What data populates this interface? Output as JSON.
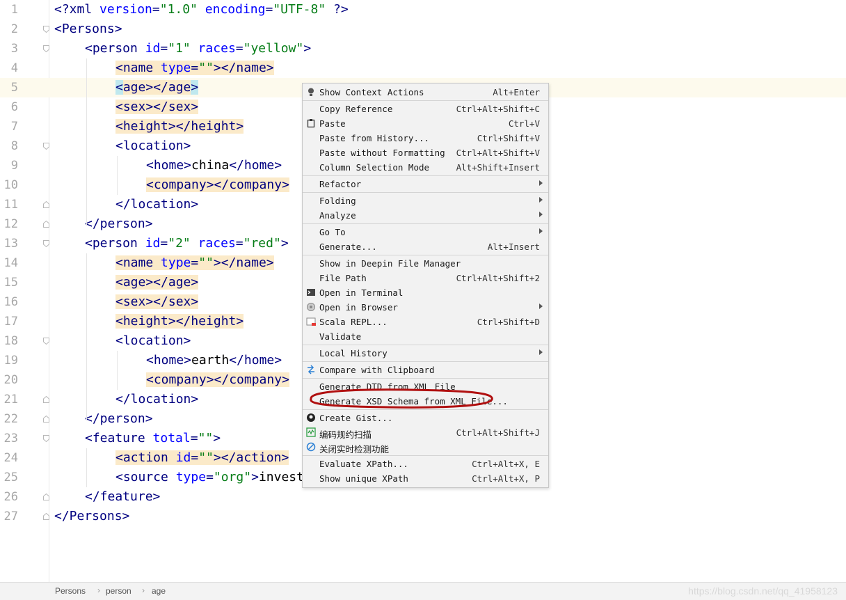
{
  "editor": {
    "lines": [
      {
        "n": "1",
        "parts": [
          [
            "decl",
            "<?xml "
          ],
          [
            "attr",
            "version"
          ],
          [
            "decl",
            "="
          ],
          [
            "val",
            "\"1.0\""
          ],
          [
            "decl",
            " "
          ],
          [
            "attr",
            "encoding"
          ],
          [
            "decl",
            "="
          ],
          [
            "val",
            "\"UTF-8\""
          ],
          [
            "decl",
            " ?>"
          ]
        ]
      },
      {
        "n": "2",
        "parts": [
          [
            "tag",
            "<Persons>"
          ]
        ]
      },
      {
        "n": "3",
        "parts": [
          [
            "tag",
            "<person "
          ],
          [
            "attr",
            "id"
          ],
          [
            "tag",
            "="
          ],
          [
            "val",
            "\"1\""
          ],
          [
            "tag",
            " "
          ],
          [
            "attr",
            "races"
          ],
          [
            "tag",
            "="
          ],
          [
            "val",
            "\"yellow\""
          ],
          [
            "tag",
            ">"
          ]
        ]
      },
      {
        "n": "4",
        "parts": [
          [
            "tag hl",
            "<name "
          ],
          [
            "attr hl",
            "type"
          ],
          [
            "tag hl",
            "="
          ],
          [
            "val hl",
            "\"\""
          ],
          [
            "tag hl",
            "></name>"
          ]
        ]
      },
      {
        "n": "5",
        "parts": [
          [
            "tag hlc",
            "<"
          ],
          [
            "tag hl",
            "age></age"
          ],
          [
            "tag hlc",
            ">"
          ]
        ]
      },
      {
        "n": "6",
        "parts": [
          [
            "tag hl",
            "<sex></sex>"
          ]
        ]
      },
      {
        "n": "7",
        "parts": [
          [
            "tag hl",
            "<height></height>"
          ]
        ]
      },
      {
        "n": "8",
        "parts": [
          [
            "tag",
            "<location>"
          ]
        ]
      },
      {
        "n": "9",
        "parts": [
          [
            "tag",
            "<home>"
          ],
          [
            "txt",
            "china"
          ],
          [
            "tag",
            "</home>"
          ]
        ]
      },
      {
        "n": "10",
        "parts": [
          [
            "tag hl",
            "<company></company>"
          ]
        ]
      },
      {
        "n": "11",
        "parts": [
          [
            "tag",
            "</location>"
          ]
        ]
      },
      {
        "n": "12",
        "parts": [
          [
            "tag",
            "</person>"
          ]
        ]
      },
      {
        "n": "13",
        "parts": [
          [
            "tag",
            "<person "
          ],
          [
            "attr",
            "id"
          ],
          [
            "tag",
            "="
          ],
          [
            "val",
            "\"2\""
          ],
          [
            "tag",
            " "
          ],
          [
            "attr",
            "races"
          ],
          [
            "tag",
            "="
          ],
          [
            "val",
            "\"red\""
          ],
          [
            "tag",
            ">"
          ]
        ]
      },
      {
        "n": "14",
        "parts": [
          [
            "tag hl",
            "<name "
          ],
          [
            "attr hl",
            "type"
          ],
          [
            "tag hl",
            "="
          ],
          [
            "val hl",
            "\"\""
          ],
          [
            "tag hl",
            "></name>"
          ]
        ]
      },
      {
        "n": "15",
        "parts": [
          [
            "tag hl",
            "<age></age>"
          ]
        ]
      },
      {
        "n": "16",
        "parts": [
          [
            "tag hl",
            "<sex></sex>"
          ]
        ]
      },
      {
        "n": "17",
        "parts": [
          [
            "tag hl",
            "<height></height>"
          ]
        ]
      },
      {
        "n": "18",
        "parts": [
          [
            "tag",
            "<location>"
          ]
        ]
      },
      {
        "n": "19",
        "parts": [
          [
            "tag",
            "<home>"
          ],
          [
            "txt",
            "earth"
          ],
          [
            "tag",
            "</home>"
          ]
        ]
      },
      {
        "n": "20",
        "parts": [
          [
            "tag hl",
            "<company></company>"
          ]
        ]
      },
      {
        "n": "21",
        "parts": [
          [
            "tag",
            "</location>"
          ]
        ]
      },
      {
        "n": "22",
        "parts": [
          [
            "tag",
            "</person>"
          ]
        ]
      },
      {
        "n": "23",
        "parts": [
          [
            "tag",
            "<feature "
          ],
          [
            "attr",
            "total"
          ],
          [
            "tag",
            "="
          ],
          [
            "val",
            "\"\""
          ],
          [
            "tag",
            ">"
          ]
        ]
      },
      {
        "n": "24",
        "parts": [
          [
            "tag hl",
            "<action "
          ],
          [
            "attr hl",
            "id"
          ],
          [
            "tag hl",
            "="
          ],
          [
            "val hl",
            "\"\""
          ],
          [
            "tag hl",
            "></action>"
          ]
        ]
      },
      {
        "n": "25",
        "parts": [
          [
            "tag",
            "<source "
          ],
          [
            "attr",
            "type"
          ],
          [
            "tag",
            "="
          ],
          [
            "val",
            "\"org\""
          ],
          [
            "tag",
            ">"
          ],
          [
            "txt",
            "invest"
          ]
        ]
      },
      {
        "n": "26",
        "parts": [
          [
            "tag",
            "</feature>"
          ]
        ]
      },
      {
        "n": "27",
        "parts": [
          [
            "tag",
            "</Persons>"
          ]
        ]
      }
    ]
  },
  "context_menu": {
    "items": [
      {
        "label": "Show Context Actions",
        "shortcut": "Alt+Enter",
        "icon": "bulb-icon"
      },
      {
        "sep": true
      },
      {
        "label": "Copy Reference",
        "shortcut": "Ctrl+Alt+Shift+C"
      },
      {
        "label": "Paste",
        "shortcut": "Ctrl+V",
        "icon": "clipboard-icon"
      },
      {
        "label": "Paste from History...",
        "shortcut": "Ctrl+Shift+V"
      },
      {
        "label": "Paste without Formatting",
        "shortcut": "Ctrl+Alt+Shift+V"
      },
      {
        "label": "Column Selection Mode",
        "shortcut": "Alt+Shift+Insert"
      },
      {
        "sep": true
      },
      {
        "label": "Refactor",
        "submenu": true
      },
      {
        "sep": true
      },
      {
        "label": "Folding",
        "submenu": true
      },
      {
        "label": "Analyze",
        "submenu": true
      },
      {
        "sep": true
      },
      {
        "label": "Go To",
        "submenu": true
      },
      {
        "label": "Generate...",
        "shortcut": "Alt+Insert"
      },
      {
        "sep": true
      },
      {
        "label": "Show in Deepin File Manager"
      },
      {
        "label": "File Path",
        "shortcut": "Ctrl+Alt+Shift+2"
      },
      {
        "label": "Open in Terminal",
        "icon": "terminal-icon"
      },
      {
        "label": "Open in Browser",
        "submenu": true,
        "icon": "browser-icon"
      },
      {
        "label": "Scala REPL...",
        "shortcut": "Ctrl+Shift+D",
        "icon": "repl-icon"
      },
      {
        "label": "Validate"
      },
      {
        "sep": true
      },
      {
        "label": "Local History",
        "submenu": true
      },
      {
        "sep": true
      },
      {
        "label": "Compare with Clipboard",
        "icon": "compare-icon"
      },
      {
        "sep": true
      },
      {
        "label": "Generate DTD from XML File"
      },
      {
        "label": "Generate XSD Schema from XML File..."
      },
      {
        "sep": true
      },
      {
        "label": "Create Gist...",
        "icon": "github-icon"
      },
      {
        "label": "编码规约扫描",
        "shortcut": "Ctrl+Alt+Shift+J",
        "icon": "scan-icon"
      },
      {
        "label": "关闭实时检测功能",
        "icon": "disable-icon"
      },
      {
        "sep": true
      },
      {
        "label": "Evaluate XPath...",
        "shortcut": "Ctrl+Alt+X, E"
      },
      {
        "label": "Show unique XPath",
        "shortcut": "Ctrl+Alt+X, P"
      }
    ]
  },
  "status_bar": {
    "breadcrumbs": [
      "Persons",
      "person",
      "age"
    ]
  },
  "watermark": "https://blog.csdn.net/qq_41958123",
  "colors": {
    "highlight": "#fbeac9",
    "annotation": "#b01010"
  }
}
